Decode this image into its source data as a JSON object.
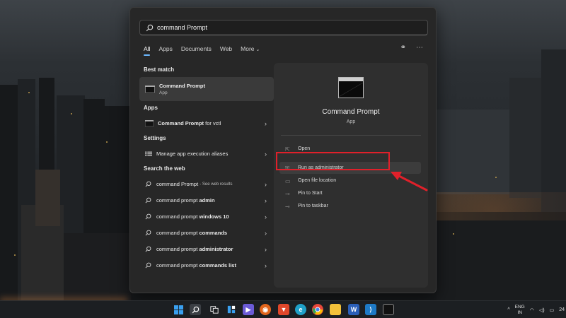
{
  "search": {
    "value": "command Prompt"
  },
  "tabs": [
    {
      "label": "All",
      "active": true
    },
    {
      "label": "Apps"
    },
    {
      "label": "Documents"
    },
    {
      "label": "Web"
    },
    {
      "label": "More"
    }
  ],
  "tab_icons": {
    "share": "share-icon",
    "more": "ellipsis-icon"
  },
  "sections": {
    "best_match": "Best match",
    "apps": "Apps",
    "settings": "Settings",
    "web": "Search the web"
  },
  "best_match": {
    "title": "Command Prompt",
    "subtitle": "App"
  },
  "apps": [
    {
      "label": "Command Prompt for vctl"
    }
  ],
  "settings": [
    {
      "label": "Manage app execution aliases"
    }
  ],
  "web": [
    {
      "prefix": "command Prompt",
      "suffix": "",
      "hint": " - See web results"
    },
    {
      "prefix": "command prompt ",
      "suffix": "admin",
      "hint": ""
    },
    {
      "prefix": "command prompt ",
      "suffix": "windows 10",
      "hint": ""
    },
    {
      "prefix": "command prompt ",
      "suffix": "commands",
      "hint": ""
    },
    {
      "prefix": "command prompt ",
      "suffix": "administrator",
      "hint": ""
    },
    {
      "prefix": "command prompt ",
      "suffix": "commands list",
      "hint": ""
    }
  ],
  "preview": {
    "title": "Command Prompt",
    "subtitle": "App",
    "actions": [
      {
        "label": "Open",
        "icon": "open-icon"
      },
      {
        "label": "Run as administrator",
        "icon": "shield-icon"
      },
      {
        "label": "Open file location",
        "icon": "folder-icon"
      },
      {
        "label": "Pin to Start",
        "icon": "pin-icon"
      },
      {
        "label": "Pin to taskbar",
        "icon": "pin-icon"
      }
    ]
  },
  "annotation": {
    "color": "#e0202a"
  },
  "taskbar": {
    "apps": [
      "windows-start",
      "search",
      "task-view",
      "widgets",
      "chat",
      "firefox",
      "brave",
      "edge",
      "chrome",
      "file-explorer",
      "word",
      "vscode",
      "terminal"
    ],
    "lang_top": "ENG",
    "lang_bottom": "IN",
    "clock": "24"
  }
}
